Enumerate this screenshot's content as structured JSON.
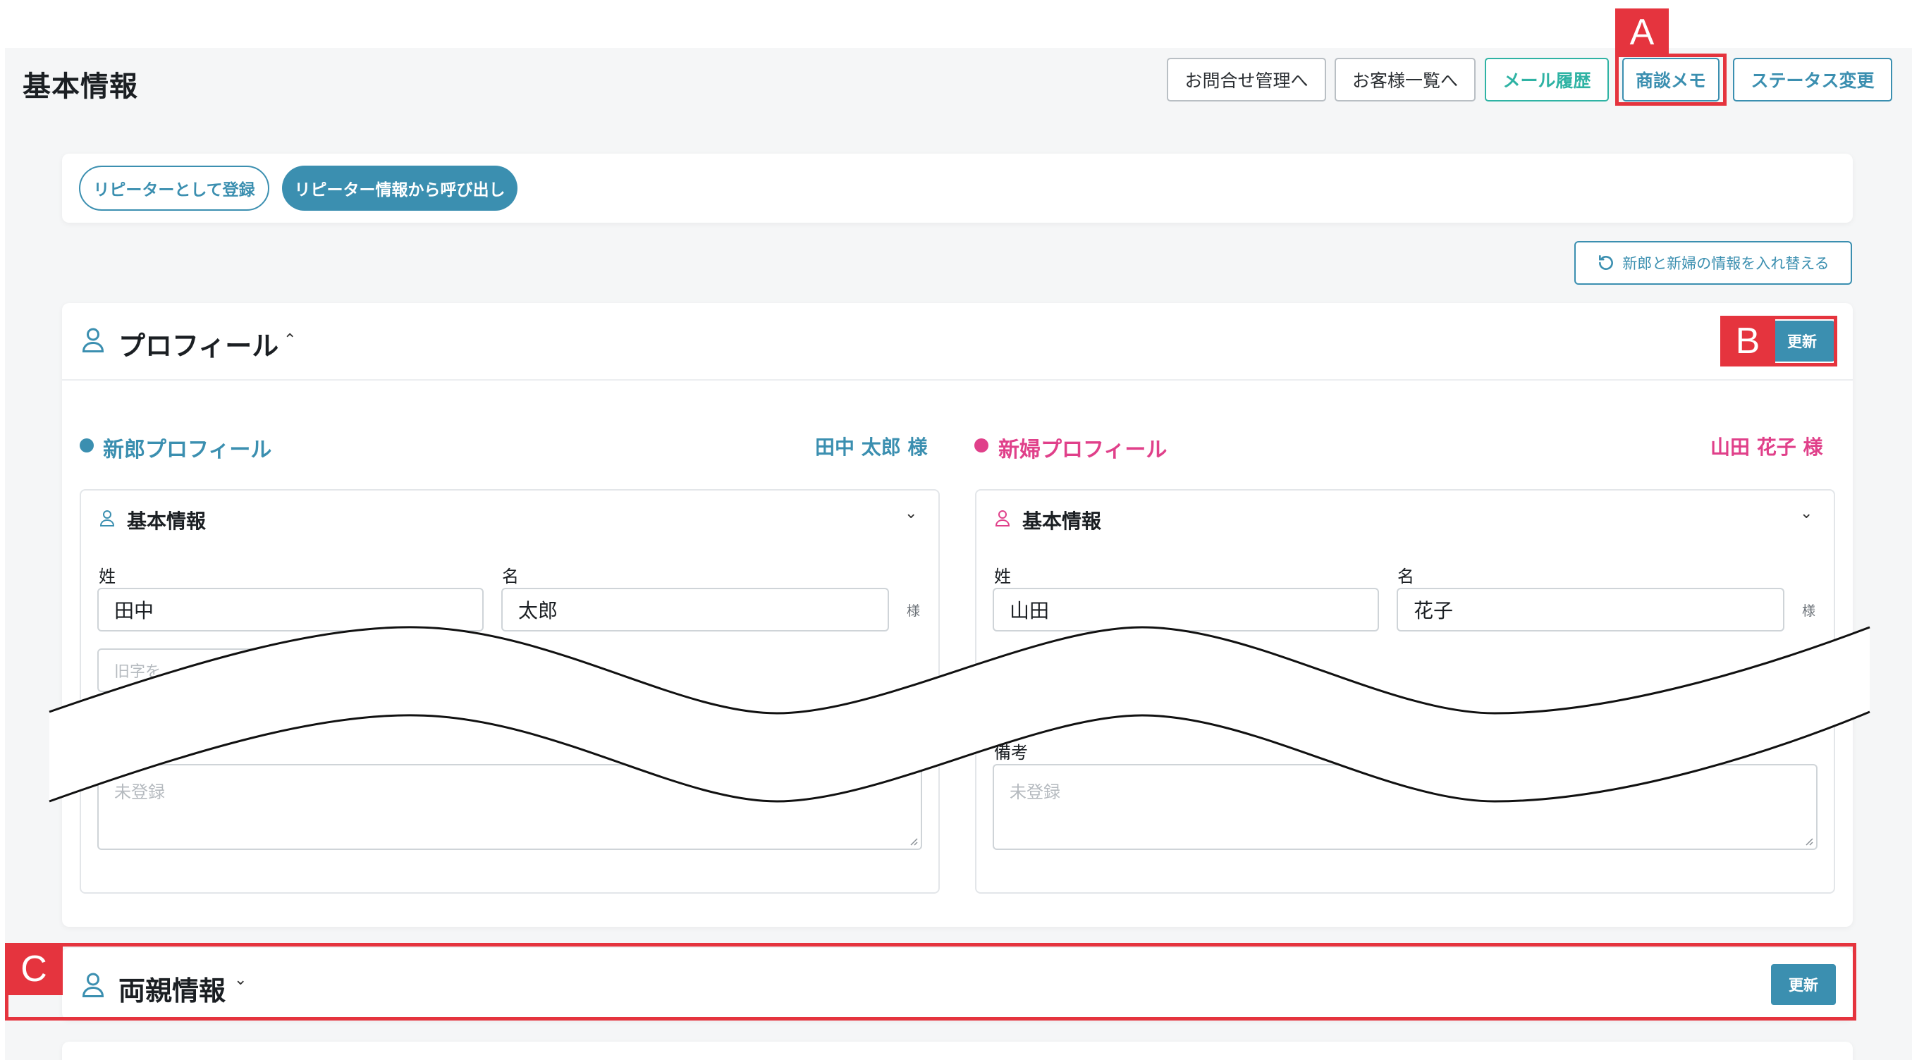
{
  "header": {
    "title": "基本情報",
    "buttons": {
      "inquiry": "お問合せ管理へ",
      "customers": "お客様一覧へ",
      "mail_history": "メール履歴",
      "memo": "商談メモ",
      "status": "ステータス変更"
    }
  },
  "repeater": {
    "register": "リピーターとして登録",
    "load": "リピーター情報から呼び出し"
  },
  "swap_button": "新郎と新婦の情報を入れ替える",
  "profile": {
    "title": "プロフィール",
    "update": "更新",
    "groom": {
      "label": "新郎プロフィール",
      "name": "田中 太郎 様",
      "section": "基本情報",
      "last_name_label": "姓",
      "first_name_label": "名",
      "last_name": "田中",
      "first_name": "太郎",
      "honorific": "様",
      "maiden_placeholder": "旧字を",
      "notes_placeholder": "未登録"
    },
    "bride": {
      "label": "新婦プロフィール",
      "name": "山田 花子 様",
      "section": "基本情報",
      "last_name_label": "姓",
      "first_name_label": "名",
      "last_name": "山田",
      "first_name": "花子",
      "honorific": "様",
      "notes_label": "備考",
      "notes_placeholder": "未登録"
    }
  },
  "parents": {
    "title": "両親情報",
    "update": "更新"
  },
  "annotations": {
    "a": "A",
    "b": "B",
    "c": "C"
  },
  "colors": {
    "primary": "#3b8fb0",
    "teal": "#2fb3a4",
    "bride": "#e0408a",
    "highlight": "#e5343e"
  },
  "icons": [
    "user-icon",
    "chevron-up-icon",
    "chevron-down-icon",
    "swap-icon"
  ]
}
